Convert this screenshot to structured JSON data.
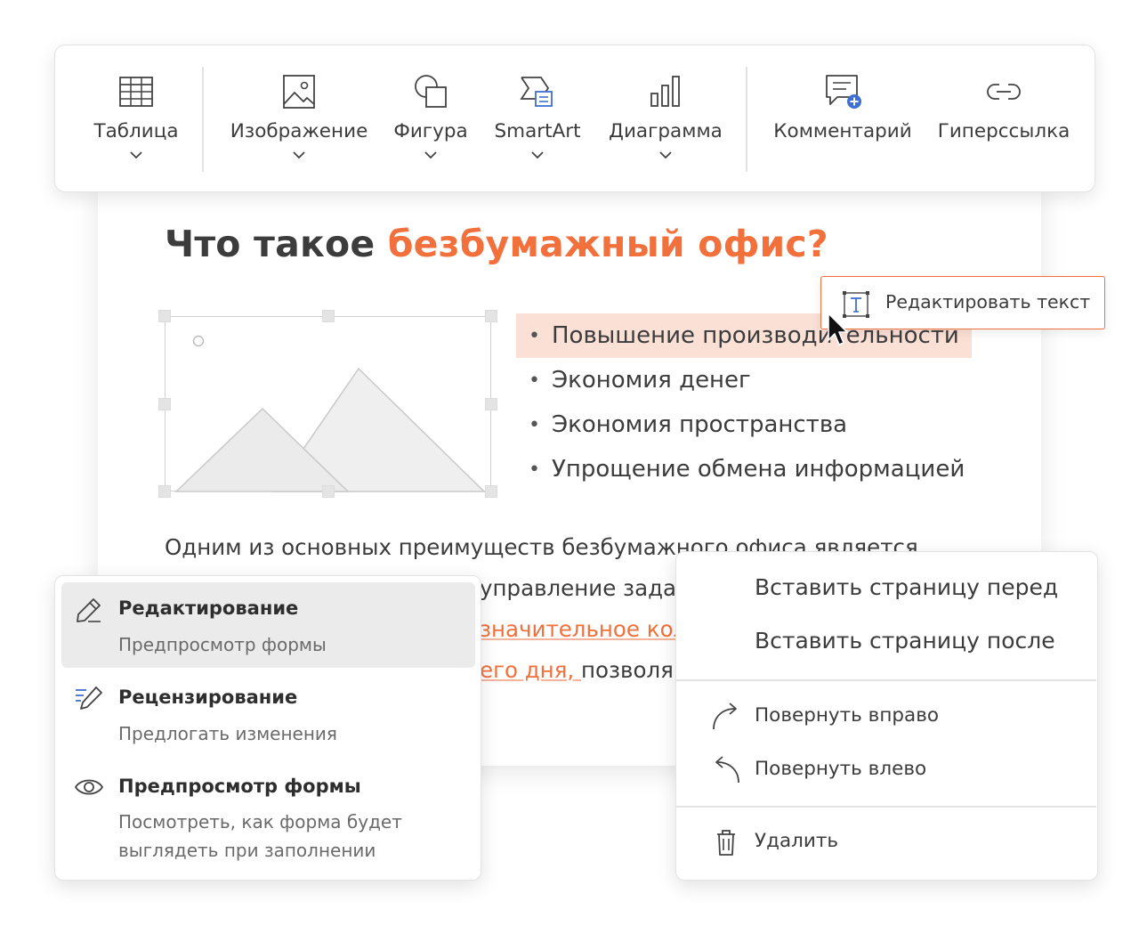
{
  "toolbar": {
    "items": [
      {
        "label": "Таблица",
        "icon": "table-icon",
        "has_dropdown": true
      },
      {
        "label": "Изображение",
        "icon": "image-icon",
        "has_dropdown": true
      },
      {
        "label": "Фигура",
        "icon": "shape-icon",
        "has_dropdown": true
      },
      {
        "label": "SmartArt",
        "icon": "smartart-icon",
        "has_dropdown": true
      },
      {
        "label": "Диаграмма",
        "icon": "chart-icon",
        "has_dropdown": true
      },
      {
        "label": "Комментарий",
        "icon": "comment-add-icon",
        "has_dropdown": false
      },
      {
        "label": "Гиперссылка",
        "icon": "link-icon",
        "has_dropdown": false
      }
    ]
  },
  "document": {
    "title_prefix": "Что такое ",
    "title_accent": "безбумажный офис?",
    "bullets": [
      "Повышение производительности",
      "Экономия денег",
      "Экономия пространства",
      "Упрощение обмена информацией"
    ],
    "body_lines": [
      "Одним из основных преимуществ безбумажного офиса является",
      "управление задачами",
      "значительное коли",
      "его дня, ",
      "позволя"
    ]
  },
  "tooltip": {
    "label": "Редактировать текст",
    "icon": "text-box-icon"
  },
  "mode_menu": {
    "items": [
      {
        "title": "Редактирование",
        "subtitle": "Предпросмотр формы",
        "icon": "pencil-icon",
        "active": true
      },
      {
        "title": "Рецензирование",
        "subtitle": "Предлогать изменения",
        "icon": "review-pen-icon",
        "active": false
      },
      {
        "title": "Предпросмотр формы",
        "subtitle": "Посмотреть, как форма будет выглядеть при заполнении",
        "icon": "eye-icon",
        "active": false
      }
    ]
  },
  "context_menu": {
    "insert_before": "Вставить страницу перед",
    "insert_after": "Вставить страницу после",
    "rotate_right": "Повернуть вправо",
    "rotate_left": "Повернуть влево",
    "delete": "Удалить"
  },
  "colors": {
    "accent": "#f2703c",
    "highlight": "#fbe0d6",
    "active_bg": "#ebebeb",
    "icon_blue": "#3f6fd1"
  }
}
